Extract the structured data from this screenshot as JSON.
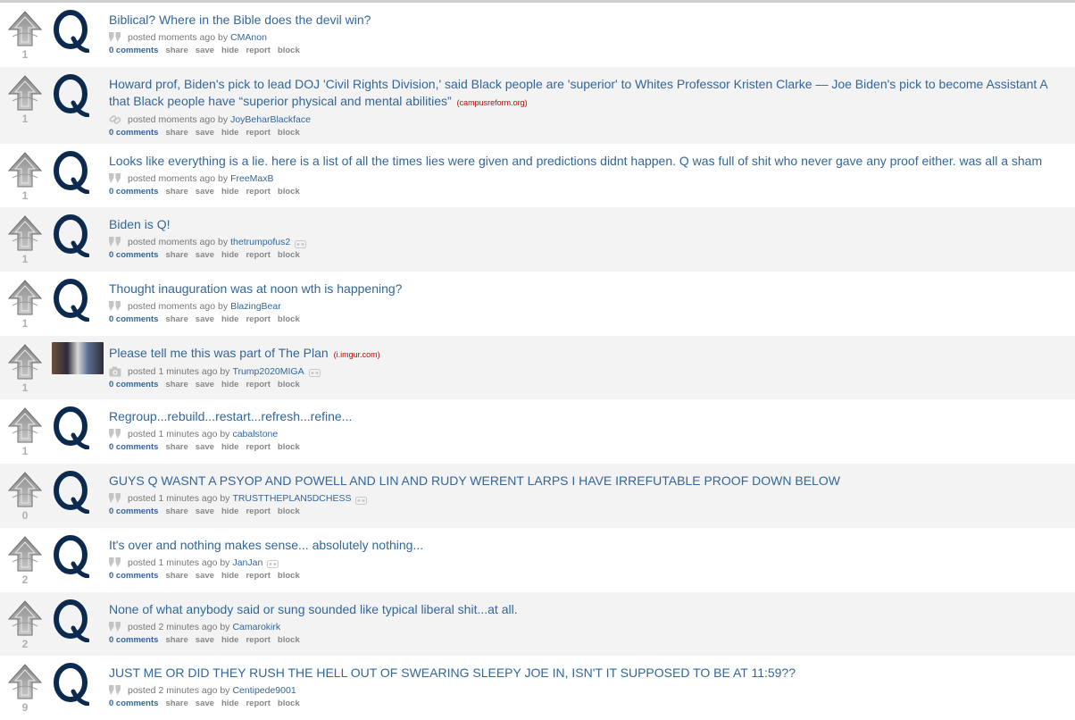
{
  "colors": {
    "title": "#336699",
    "domain": "#cc0000",
    "score": "#b0b0b0",
    "alt_row": "#f3f3f3"
  },
  "action_labels": {
    "comments": "0 comments",
    "share": "share",
    "save": "save",
    "hide": "hide",
    "report": "report",
    "block": "block"
  },
  "meta_labels": {
    "posted": "posted",
    "by": "by"
  },
  "posts": [
    {
      "score": "1",
      "title": "Biblical? Where in the Bible does the devil win?",
      "domain": "",
      "kind_icon": "quote-icon",
      "thumb": "q-logo",
      "time": "moments ago",
      "author": "CMAnon",
      "badge": false
    },
    {
      "score": "1",
      "title": "Howard prof, Biden's pick to lead DOJ 'Civil Rights Division,' said Black people are 'superior' to Whites Professor Kristen Clarke — Joe Biden's pick to become Assistant A",
      "title2": "that Black people have “superior physical and mental abilities”",
      "domain": "(campusreform.org)",
      "kind_icon": "link-icon",
      "thumb": "q-logo",
      "time": "moments ago",
      "author": "JoyBeharBlackface",
      "badge": false
    },
    {
      "score": "1",
      "title": "Looks like everything is a lie. here is a list of all the times lies were given and predictions didnt happen. Q was full of shit who never gave any proof either. was all a sham",
      "domain": "",
      "kind_icon": "quote-icon",
      "thumb": "q-logo",
      "time": "moments ago",
      "author": "FreeMaxB",
      "badge": false
    },
    {
      "score": "1",
      "title": "Biden is Q!",
      "domain": "",
      "kind_icon": "quote-icon",
      "thumb": "q-logo",
      "time": "moments ago",
      "author": "thetrumpofus2",
      "badge": true
    },
    {
      "score": "1",
      "title": "Thought inauguration was at noon wth is happening?",
      "domain": "",
      "kind_icon": "quote-icon",
      "thumb": "q-logo",
      "time": "moments ago",
      "author": "BlazingBear",
      "badge": false
    },
    {
      "score": "1",
      "title": "Please tell me this was part of The Plan",
      "domain": "(i.imgur.com)",
      "kind_icon": "camera-icon",
      "thumb": "photo",
      "time": "1 minutes ago",
      "author": "Trump2020MIGA",
      "badge": true
    },
    {
      "score": "1",
      "title": "Regroup...rebuild...restart...refresh...refine...",
      "domain": "",
      "kind_icon": "quote-icon",
      "thumb": "q-logo",
      "time": "1 minutes ago",
      "author": "cabalstone",
      "badge": false
    },
    {
      "score": "0",
      "title": "GUYS Q WASNT A PSYOP AND POWELL AND LIN AND RUDY WERENT LARPS I HAVE IRREFUTABLE PROOF DOWN BELOW",
      "domain": "",
      "kind_icon": "quote-icon",
      "thumb": "q-logo",
      "time": "1 minutes ago",
      "author": "TRUSTTHEPLAN5DCHESS",
      "badge": true
    },
    {
      "score": "2",
      "title": "It's over and nothing makes sense... absolutely nothing...",
      "domain": "",
      "kind_icon": "quote-icon",
      "thumb": "q-logo",
      "time": "1 minutes ago",
      "author": "JanJan",
      "badge": true
    },
    {
      "score": "2",
      "title": "None of what anybody said or sung sounded like typical liberal shit...at all.",
      "domain": "",
      "kind_icon": "quote-icon",
      "thumb": "q-logo",
      "time": "2 minutes ago",
      "author": "Camarokirk",
      "badge": false
    },
    {
      "score": "9",
      "title": "JUST ME OR DID THEY RUSH THE HELL OUT OF SWEARING SLEEPY JOE IN, ISN'T IT SUPPOSED TO BE AT 11:59??",
      "domain": "",
      "kind_icon": "quote-icon",
      "thumb": "q-logo",
      "time": "2 minutes ago",
      "author": "Centipede9001",
      "badge": false
    }
  ]
}
